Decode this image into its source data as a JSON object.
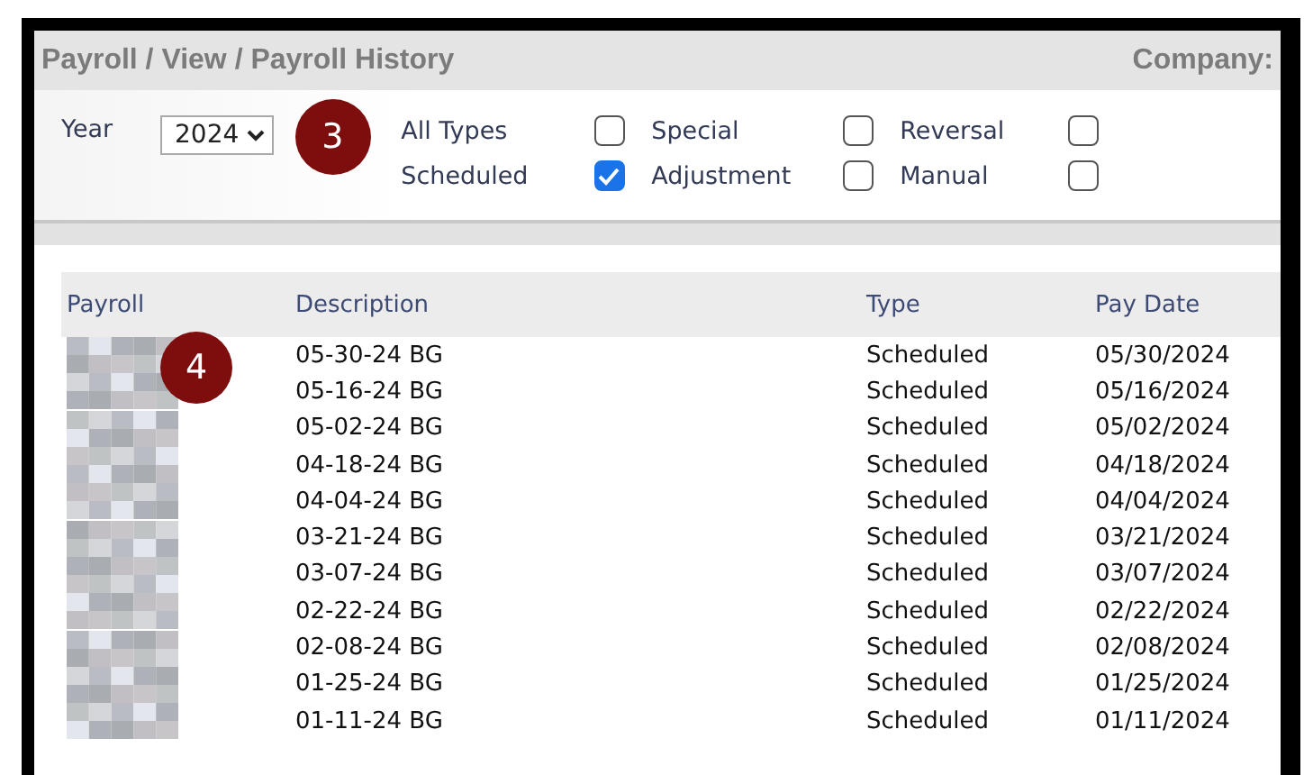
{
  "breadcrumb": "Payroll / View / Payroll History",
  "company_label": "Company:",
  "filters": {
    "year_label": "Year",
    "year": "2024",
    "types": [
      {
        "label": "All Types",
        "checked": false
      },
      {
        "label": "Special",
        "checked": false
      },
      {
        "label": "Reversal",
        "checked": false
      },
      {
        "label": "Scheduled",
        "checked": true
      },
      {
        "label": "Adjustment",
        "checked": false
      },
      {
        "label": "Manual",
        "checked": false
      }
    ]
  },
  "callouts": [
    {
      "number": "3"
    },
    {
      "number": "4"
    }
  ],
  "table": {
    "columns": [
      "Payroll",
      "Description",
      "Type",
      "Pay Date"
    ],
    "rows": [
      {
        "description": "05-30-24 BG",
        "type": "Scheduled",
        "pay_date": "05/30/2024"
      },
      {
        "description": "05-16-24 BG",
        "type": "Scheduled",
        "pay_date": "05/16/2024"
      },
      {
        "description": "05-02-24 BG",
        "type": "Scheduled",
        "pay_date": "05/02/2024"
      },
      {
        "description": "04-18-24 BG",
        "type": "Scheduled",
        "pay_date": "04/18/2024"
      },
      {
        "description": "04-04-24 BG",
        "type": "Scheduled",
        "pay_date": "04/04/2024"
      },
      {
        "description": "03-21-24 BG",
        "type": "Scheduled",
        "pay_date": "03/21/2024"
      },
      {
        "description": "03-07-24 BG",
        "type": "Scheduled",
        "pay_date": "03/07/2024"
      },
      {
        "description": "02-22-24 BG",
        "type": "Scheduled",
        "pay_date": "02/22/2024"
      },
      {
        "description": "02-08-24 BG",
        "type": "Scheduled",
        "pay_date": "02/08/2024"
      },
      {
        "description": "01-25-24 BG",
        "type": "Scheduled",
        "pay_date": "01/25/2024"
      },
      {
        "description": "01-11-24 BG",
        "type": "Scheduled",
        "pay_date": "01/11/2024"
      }
    ]
  }
}
